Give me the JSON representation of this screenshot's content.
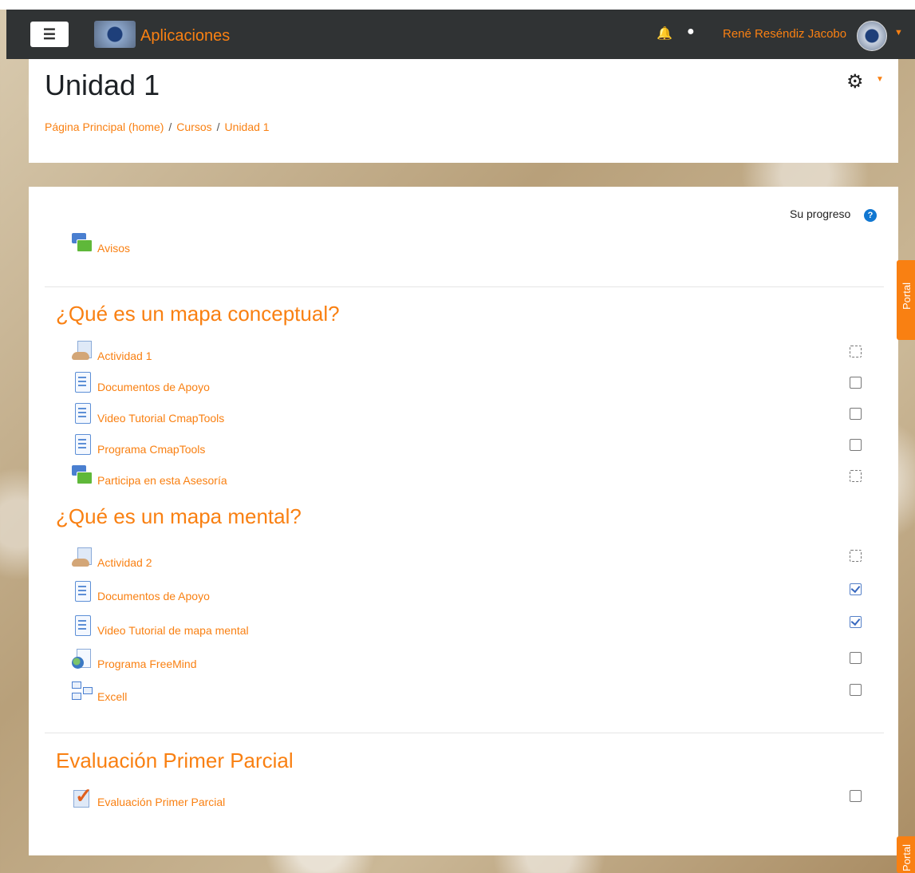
{
  "navbar": {
    "menu_icon": "hamburger-icon",
    "site_name": "Aplicaciones",
    "user_name": "René Reséndiz Jacobo"
  },
  "header": {
    "title": "Unidad 1",
    "breadcrumb": [
      "Página Principal (home)",
      "Cursos",
      "Unidad 1"
    ]
  },
  "course": {
    "progress_label": "Su progreso",
    "intro_item": {
      "label": "Avisos",
      "icon": "forum-icon"
    },
    "sections": [
      {
        "title": "¿Qué es un mapa conceptual?",
        "items": [
          {
            "label": "Actividad 1",
            "icon": "assignment-icon",
            "completion": "auto-incomplete"
          },
          {
            "label": "Documentos de Apoyo",
            "icon": "page-icon",
            "completion": "manual-incomplete"
          },
          {
            "label": "Video Tutorial CmapTools",
            "icon": "page-icon",
            "completion": "manual-incomplete"
          },
          {
            "label": "Programa CmapTools",
            "icon": "page-icon",
            "completion": "manual-incomplete"
          },
          {
            "label": "Participa en esta Asesoría",
            "icon": "forum-icon",
            "completion": "auto-incomplete"
          }
        ]
      },
      {
        "title": "¿Qué es un mapa mental?",
        "items": [
          {
            "label": "Actividad 2",
            "icon": "assignment-icon",
            "completion": "auto-incomplete"
          },
          {
            "label": "Documentos de Apoyo",
            "icon": "page-icon",
            "completion": "manual-complete"
          },
          {
            "label": "Video Tutorial de mapa mental",
            "icon": "page-icon",
            "completion": "manual-complete"
          },
          {
            "label": "Programa FreeMind",
            "icon": "url-icon",
            "completion": "manual-incomplete"
          },
          {
            "label": "Excell",
            "icon": "folder-icon",
            "completion": "manual-incomplete"
          }
        ]
      },
      {
        "title": "Evaluación Primer Parcial",
        "items": [
          {
            "label": "Evaluación Primer Parcial",
            "icon": "quiz-icon",
            "completion": "manual-incomplete"
          }
        ]
      }
    ]
  },
  "portal_tab": {
    "label": "Portal"
  },
  "colors": {
    "accent": "#f98012",
    "navbar": "#303334",
    "link_icon": "#1177d1"
  }
}
